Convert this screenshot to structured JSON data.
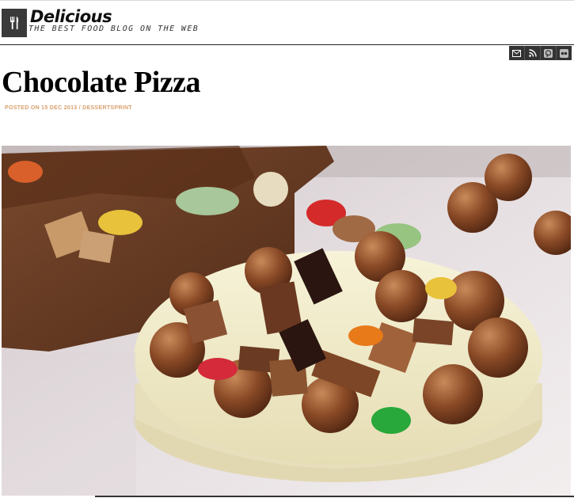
{
  "site": {
    "title": "Delicious",
    "tagline": "THE BEST FOOD BLOG ON THE WEB",
    "logo_icon": "fork-knife-icon"
  },
  "social": [
    {
      "name": "email",
      "icon": "mail-icon"
    },
    {
      "name": "rss",
      "icon": "rss-icon"
    },
    {
      "name": "pinterest",
      "icon": "pinterest-icon"
    },
    {
      "name": "flickr",
      "icon": "flickr-icon"
    }
  ],
  "post": {
    "title": "Chocolate Pizza",
    "meta_prefix": "POSTED ON 15 DEC 2013 /",
    "category": "DESSERTSPRINT"
  },
  "colors": {
    "meta_accent": "#d9a06d",
    "icon_bar": "#333333"
  }
}
